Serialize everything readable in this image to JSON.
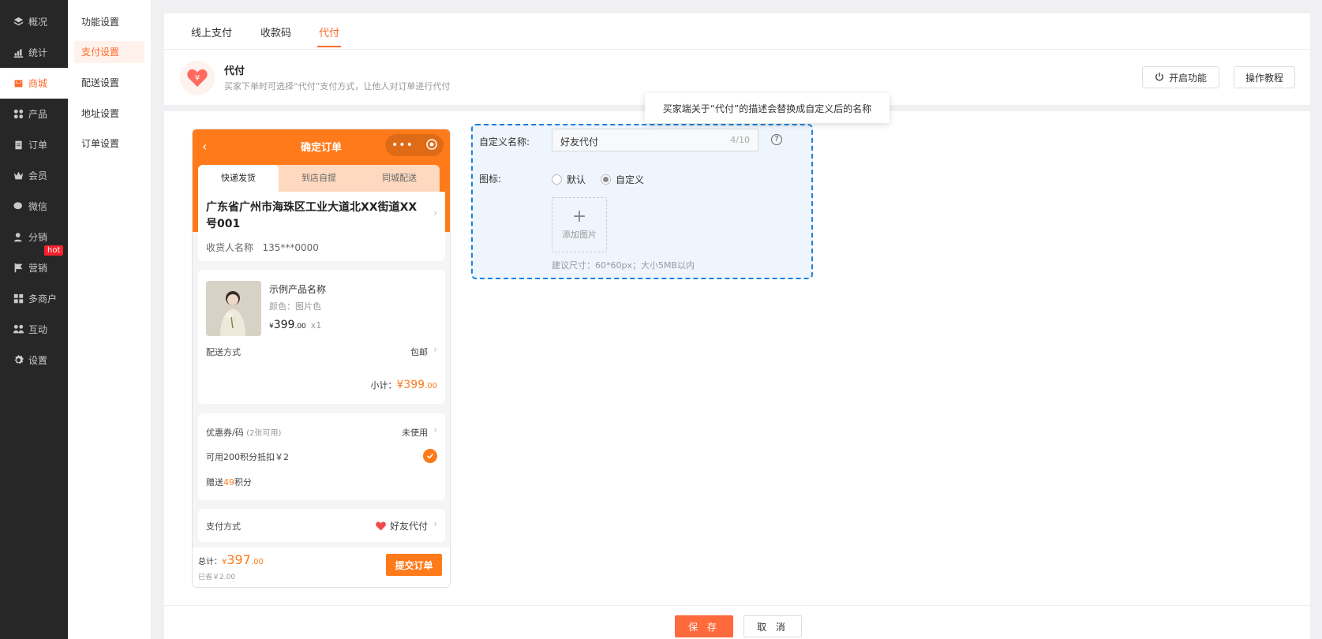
{
  "sidebar": {
    "items": [
      {
        "label": "概况",
        "icon": "layers-icon"
      },
      {
        "label": "统计",
        "icon": "chart-icon"
      },
      {
        "label": "商城",
        "icon": "store-icon"
      },
      {
        "label": "产品",
        "icon": "grid-icon"
      },
      {
        "label": "订单",
        "icon": "clipboard-icon"
      },
      {
        "label": "会员",
        "icon": "crown-icon"
      },
      {
        "label": "微信",
        "icon": "wechat-icon"
      },
      {
        "label": "分销",
        "icon": "user-icon"
      },
      {
        "label": "营销",
        "icon": "flag-icon"
      },
      {
        "label": "多商户",
        "icon": "shops-icon"
      },
      {
        "label": "互动",
        "icon": "people-icon"
      },
      {
        "label": "设置",
        "icon": "gear-icon"
      }
    ],
    "hot_badge": "hot"
  },
  "subnav": {
    "items": [
      "功能设置",
      "支付设置",
      "配送设置",
      "地址设置",
      "订单设置"
    ]
  },
  "tabs": [
    "线上支付",
    "收款码",
    "代付"
  ],
  "feature": {
    "title": "代付",
    "desc": "买家下单时可选择“代付”支付方式，让他人对订单进行代付",
    "enable_label": "开启功能",
    "tutorial_label": "操作教程"
  },
  "phone": {
    "title": "确定订单",
    "ship_tabs": [
      "快递发货",
      "到店自提",
      "同城配送"
    ],
    "address": "广东省广州市海珠区工业大道北XX街道XX号001",
    "receiver": "收货人名称   135***0000",
    "product_name": "示例产品名称",
    "product_color": "颜色：图片色",
    "currency": "¥",
    "price_int": "399",
    "price_dec": ".00",
    "qty": "x1",
    "delivery_label": "配送方式",
    "delivery_value": "包邮",
    "subtotal_label": "小计：",
    "subtotal_int": "¥399",
    "subtotal_dec": ".00",
    "coupon_label": "优惠券/码",
    "coupon_avail": "(2张可用)",
    "coupon_value": "未使用",
    "points_label": "可用200积分抵扣￥2",
    "gift_prefix": "赠送",
    "gift_points": "49",
    "gift_suffix": "积分",
    "pay_label": "支付方式",
    "pay_value": "好友代付",
    "total_label": "总计：",
    "total_int": "397",
    "total_dec": ".00",
    "saved": "已省￥2.00",
    "submit_label": "提交订单"
  },
  "form": {
    "name_label": "自定义名称:",
    "name_value": "好友代付",
    "name_count": "4/10",
    "icon_label": "图标:",
    "radio_default": "默认",
    "radio_custom": "自定义",
    "upload_label": "添加图片",
    "hint": "建议尺寸：60*60px；大小5MB以内"
  },
  "tooltip": "买家端关于“代付”的描述会替换成自定义后的名称",
  "footer": {
    "save_label": "保 存",
    "cancel_label": "取 消"
  },
  "colors": {
    "accent": "#ff6a2b",
    "phone_orange": "#ff7a1a",
    "form_border": "#1e7fe0"
  }
}
